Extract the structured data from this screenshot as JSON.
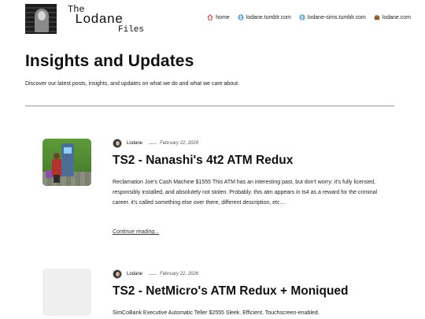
{
  "header": {
    "logo_lines": [
      "The",
      "Lodane",
      "Files"
    ],
    "nav": [
      {
        "label": "home",
        "icon": "home-icon",
        "color": "#c0392b"
      },
      {
        "label": "lodane.tumblr.com",
        "icon": "globe-icon",
        "color": "#2e86c1"
      },
      {
        "label": "lodane-sims.tumblr.com",
        "icon": "globe-icon",
        "color": "#2e86c1"
      },
      {
        "label": "lodane.com",
        "icon": "briefcase-icon",
        "color": "#8e5a2b"
      }
    ]
  },
  "page": {
    "title": "Insights and Updates",
    "description": "Discover our latest posts, insights, and updates on what we do and what we care about."
  },
  "posts": [
    {
      "author": "Lodane",
      "date": "February 22, 2026",
      "title": "TS2 - Nanashi's 4t2 ATM Redux",
      "excerpt": "Reclamation Joe's Cash Machine $1555 This ATM has an interesting past, but don't worry: it's fully licensed, responsibly installed, and absolutely not stolen. Probably. this atm appears in ts4 as a reward for the criminal career. it's called something else over there, different description, etc...",
      "read_more": "Continue reading..."
    },
    {
      "author": "Lodane",
      "date": "February 22, 2026",
      "title": "TS2 - NetMicro's ATM Redux + Moniqued",
      "excerpt": "SimCoBank Executive Automatic Teller $2555 Sleek. Efficient. Touchscreen-enabled."
    }
  ]
}
